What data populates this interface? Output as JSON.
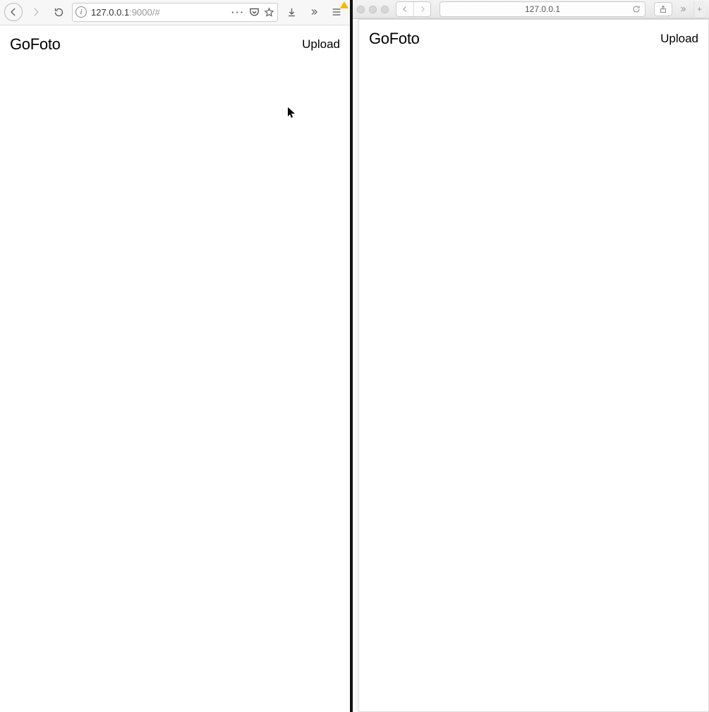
{
  "left": {
    "toolbar": {
      "url_host": "127.0.0.1",
      "url_rest": ":9000/#"
    },
    "app": {
      "title": "GoFoto",
      "upload_label": "Upload"
    }
  },
  "right": {
    "toolbar": {
      "url_display": "127.0.0.1"
    },
    "app": {
      "title": "GoFoto",
      "upload_label": "Upload"
    }
  }
}
